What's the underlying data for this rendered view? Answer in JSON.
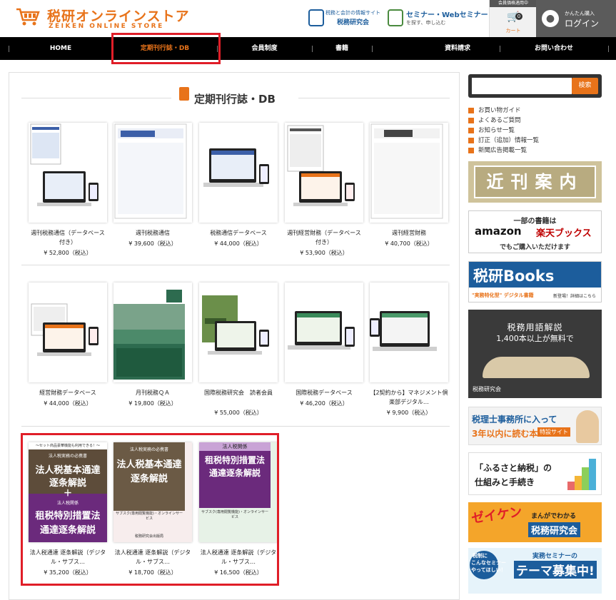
{
  "header": {
    "logo_title": "税研オンラインストア",
    "logo_sub": "ZEIKEN ONLINE STORE",
    "ext1_small": "税務と会計の情報サイト",
    "ext1_main": "税務研究会",
    "ext2_main": "セミナー・Webセミナー",
    "ext2_small": "を探す、申し込む",
    "cart_top": "会員価格適用中",
    "cart_count": "0",
    "cart_label": "カート",
    "login_sub": "かんたん購入",
    "login_main": "ログイン"
  },
  "nav": [
    "HOME",
    "定期刊行誌・DB",
    "会員制度",
    "書籍",
    "資料請求",
    "お問い合わせ"
  ],
  "section_title": "定期刊行誌・DB",
  "products_row1": [
    {
      "name": "週刊税務通信（データベース付き）",
      "price": "¥ 52,800（税込）"
    },
    {
      "name": "週刊税務通信",
      "price": "¥ 39,600（税込）"
    },
    {
      "name": "税務通信データベース",
      "price": "¥ 44,000（税込）"
    },
    {
      "name": "週刊経営財務（データベース付き）",
      "price": "¥ 53,900（税込）"
    },
    {
      "name": "週刊経営財務",
      "price": "¥ 40,700（税込）"
    }
  ],
  "products_row2": [
    {
      "name": "経営財務データベース",
      "price": "¥ 44,000（税込）"
    },
    {
      "name": "月刊税務ＱＡ",
      "price": "¥ 19,800（税込）"
    },
    {
      "name": "国際税務研究会　読者会員",
      "price": "¥ 55,000（税込）"
    },
    {
      "name": "国際税務データベース",
      "price": "¥ 46,200（税込）"
    },
    {
      "name": "【2契約から】マネジメント倶楽部デジタル…",
      "price": "¥ 9,900（税込）"
    }
  ],
  "products_row3": [
    {
      "name": "法人税通達 逐条解説（デジタル・サブス…",
      "price": "¥ 35,200（税込）",
      "cover": [
        "～セット商品豪華機能も利用できる！～",
        "法人税実務の必携書",
        "法人税基本通達",
        "逐条解説",
        "＋",
        "法人税関係",
        "租税特別措置法",
        "通達逐条解説"
      ]
    },
    {
      "name": "法人税通達 逐条解説（デジタル・サブス…",
      "price": "¥ 18,700（税込）",
      "cover": [
        "法人税実務の必携書",
        "法人税基本通達",
        "逐条解説",
        "サブスク(専用閲覧機能)・オンラインサービス",
        "税務研究会出版局"
      ]
    },
    {
      "name": "法人税通達 逐条解説（デジタル・サブス…",
      "price": "¥ 16,500（税込）",
      "cover": [
        "法人税関係",
        "租税特別措置法",
        "通達逐条解説",
        "サブスク(専用閲覧機能)・オンラインサービス"
      ]
    }
  ],
  "sidebar": {
    "search_placeholder": "",
    "search_btn": "検索",
    "links": [
      "お買い物ガイド",
      "よくあるご質問",
      "お知らせ一覧",
      "訂正（追加）情報一覧",
      "新聞広告掲載一覧"
    ],
    "b1": "近刊案内",
    "b2a": "一部の書籍は",
    "b2b": "amazon",
    "b2c": "楽天ブックス",
    "b2d": "でもご購入いただけます",
    "b3a": "税研Books",
    "b3b": "\"実務特化型\" デジタル書籍",
    "b3c": "新登場！詳細はこちら",
    "b4a": "税務用語解説",
    "b4b": "1,400本以上が無料で",
    "b4c": "税務研究会",
    "b5a": "税理士事務所に入って",
    "b5b": "3年以内に読む本",
    "b5c": "特設サイト",
    "b6a": "「ふるさと納税」の",
    "b6b": "仕組みと手続き",
    "b7a": "ゼイケン",
    "b7b": "まんがでわかる",
    "b7c": "税務研究会",
    "b8a": "税制に",
    "b8b": "こんなセミナー",
    "b8c": "やってほしい！",
    "b8d": "実務セミナーの",
    "b8e": "テーマ募集中!"
  },
  "colors": {
    "accent": "#e8731a",
    "nav_bg": "#000000",
    "highlight": "#e01e28"
  }
}
